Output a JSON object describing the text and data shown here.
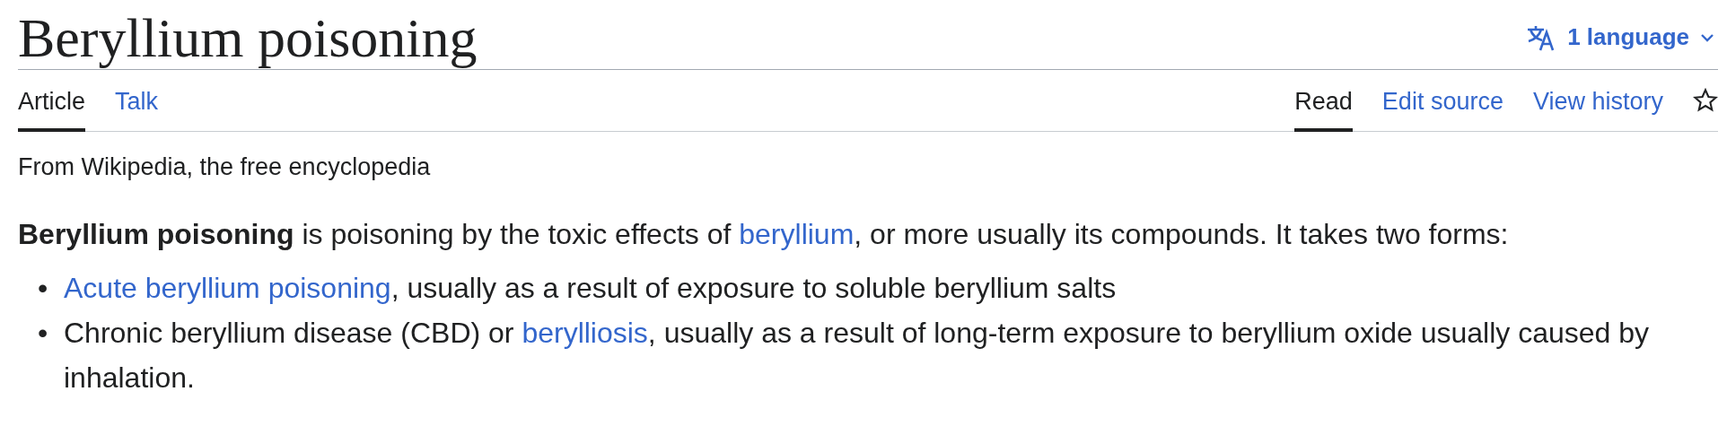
{
  "title": "Beryllium poisoning",
  "language_button": {
    "label": "1 language"
  },
  "namespace_tabs": [
    {
      "label": "Article",
      "selected": true
    },
    {
      "label": "Talk",
      "selected": false
    }
  ],
  "view_tabs": [
    {
      "label": "Read",
      "selected": true
    },
    {
      "label": "Edit source",
      "selected": false
    },
    {
      "label": "View history",
      "selected": false
    }
  ],
  "tagline": "From Wikipedia, the free encyclopedia",
  "intro": [
    {
      "kind": "text",
      "text": "**Beryllium poisoning** is poisoning by the toxic effects of "
    },
    {
      "kind": "link",
      "text": "beryllium"
    },
    {
      "kind": "text",
      "text": ", or more usually its compounds. It takes two forms:"
    }
  ],
  "list": [
    {
      "marker": "•",
      "segments": [
        {
          "kind": "link",
          "text": "Acute beryllium poisoning"
        },
        {
          "kind": "text",
          "text": ", usually as a result of exposure to soluble beryllium salts"
        }
      ]
    },
    {
      "marker": "•",
      "segments": [
        {
          "kind": "text",
          "text": "Chronic beryllium disease (CBD) or "
        },
        {
          "kind": "link",
          "text": "berylliosis"
        },
        {
          "kind": "text",
          "text": ", usually as a result of long-term exposure to beryllium oxide usually caused by inhalation."
        }
      ]
    }
  ]
}
